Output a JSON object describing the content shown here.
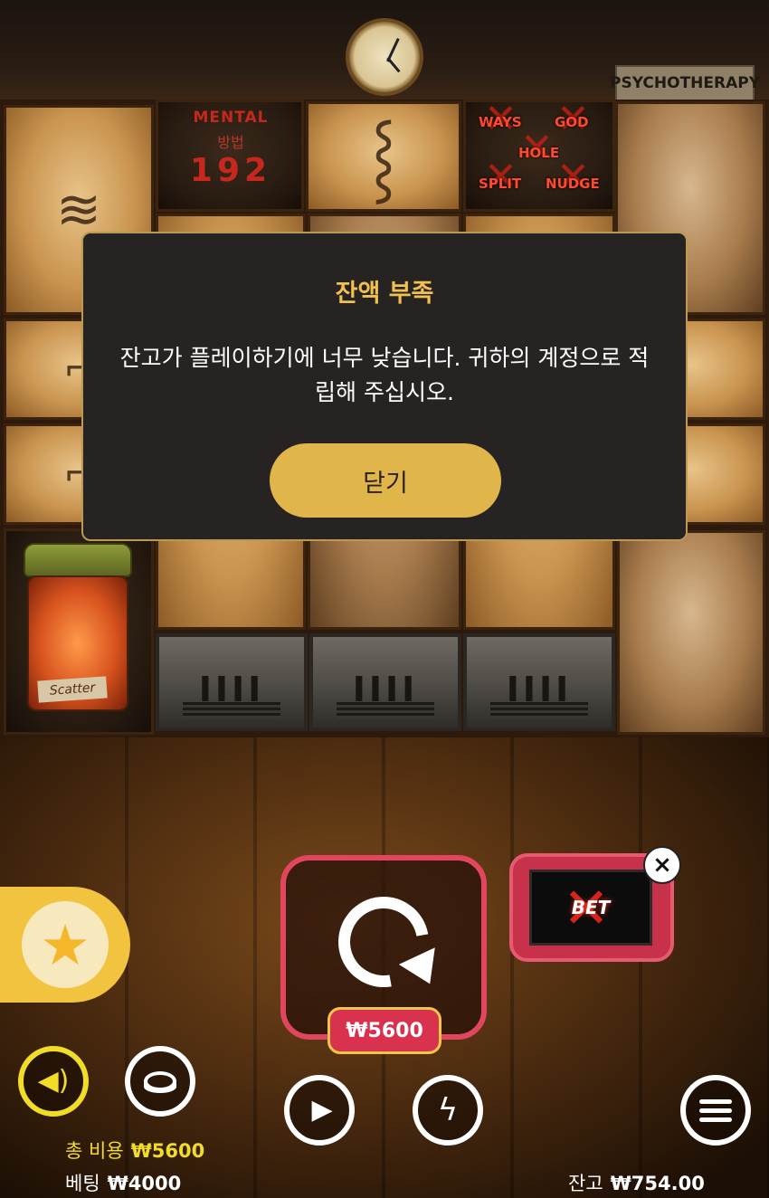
{
  "scene": {
    "sign_psychotherapy": "PSYCHOTHERAPY",
    "mental": {
      "title": "MENTAL",
      "ways_label": "방법",
      "ways_count": "192"
    },
    "features": [
      "WAYS",
      "GOD",
      "HOLE",
      "SPLIT",
      "NUDGE"
    ],
    "scatter_label": "Scatter"
  },
  "dialog": {
    "title": "잔액 부족",
    "message": "잔고가 플레이하기에 너무 낮습니다. 귀하의 계정으로 적립해 주십시오.",
    "close_label": "닫기"
  },
  "controls": {
    "spin_bet": "₩5600",
    "betx_label": "BET",
    "betx_close": "×"
  },
  "info": {
    "total_cost_label": "총 비용",
    "total_cost_value": "₩5600",
    "bet_label": "베팅",
    "bet_value": "₩4000",
    "balance_label": "잔고",
    "balance_value": "₩754.00"
  },
  "colors": {
    "accent_gold": "#f1c04f",
    "spin_border": "#e2465e",
    "sound_yellow": "#f1dc28"
  }
}
